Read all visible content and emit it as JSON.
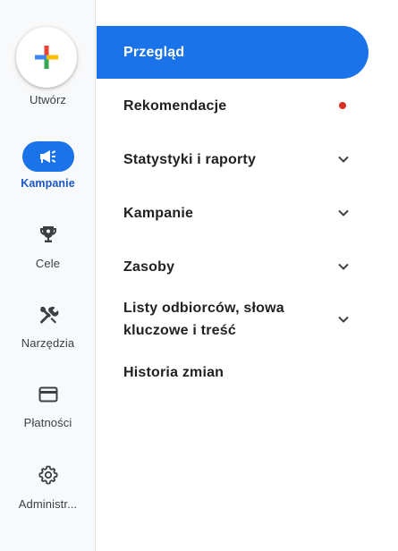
{
  "rail": {
    "create": {
      "label": "Utwórz",
      "icon": "plus-icon"
    },
    "items": [
      {
        "label": "Kampanie",
        "icon": "megaphone-icon",
        "active": true
      },
      {
        "label": "Cele",
        "icon": "trophy-icon",
        "active": false
      },
      {
        "label": "Narzędzia",
        "icon": "tools-icon",
        "active": false
      },
      {
        "label": "Płatności",
        "icon": "credit-card-icon",
        "active": false
      },
      {
        "label": "Administr...",
        "icon": "gear-icon",
        "active": false
      }
    ]
  },
  "nav": {
    "items": [
      {
        "label": "Przegląd",
        "active": true
      },
      {
        "label": "Rekomendacje",
        "badge": "red-dot"
      },
      {
        "label": "Statystyki i raporty",
        "expandable": true
      },
      {
        "label": "Kampanie",
        "expandable": true
      },
      {
        "label": "Zasoby",
        "expandable": true
      },
      {
        "label_line1": "Listy odbiorców, słowa",
        "label_line2": "kluczowe i treść",
        "expandable": true
      },
      {
        "label": "Historia zmian"
      }
    ]
  },
  "colors": {
    "accent": "#1a73e8",
    "active_text": "#1a56c4",
    "badge": "#d93025"
  }
}
